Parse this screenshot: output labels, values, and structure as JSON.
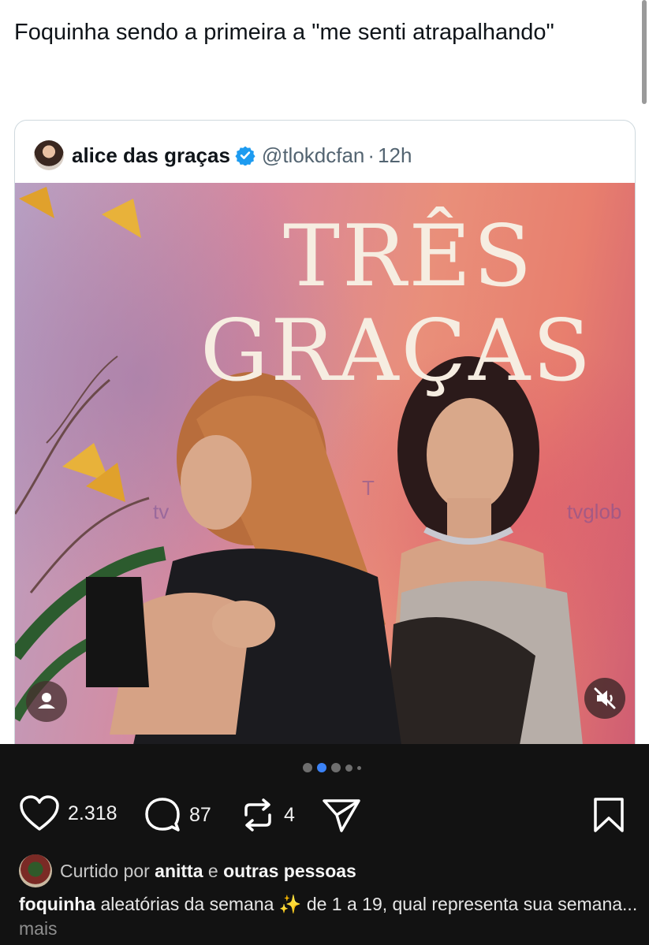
{
  "tweet": {
    "text": "Foquinha sendo a primeira a \"me senti atrapalhando\""
  },
  "quoted": {
    "name": "alice das graças",
    "handle": "@tlokdcfan",
    "separator": "·",
    "time": "12h",
    "media": {
      "title_line1": "TRÊS",
      "title_line2": "GRAÇAS",
      "watermark_left": "tv",
      "watermark_mid": "T",
      "watermark_right": "tvglob"
    }
  },
  "carousel": {
    "total": 5,
    "active": 2
  },
  "actions": {
    "likes": "2.318",
    "comments": "87",
    "reposts": "4"
  },
  "liked_by": {
    "prefix": "Curtido por",
    "user": "anitta",
    "conj": "e",
    "others": "outras pessoas"
  },
  "caption": {
    "user": "foquinha",
    "text": "aleatórias da semana ✨ de 1 a 19, qual representa sua semana...",
    "more": "mais"
  },
  "icons": [
    "heart-icon",
    "comment-icon",
    "repost-icon",
    "share-icon",
    "bookmark-icon",
    "verified-icon",
    "person-icon",
    "muted-speaker-icon"
  ],
  "colors": {
    "verified": "#1d9bf0",
    "carousel_active": "#3b82f6",
    "dark_bg": "#121212"
  }
}
